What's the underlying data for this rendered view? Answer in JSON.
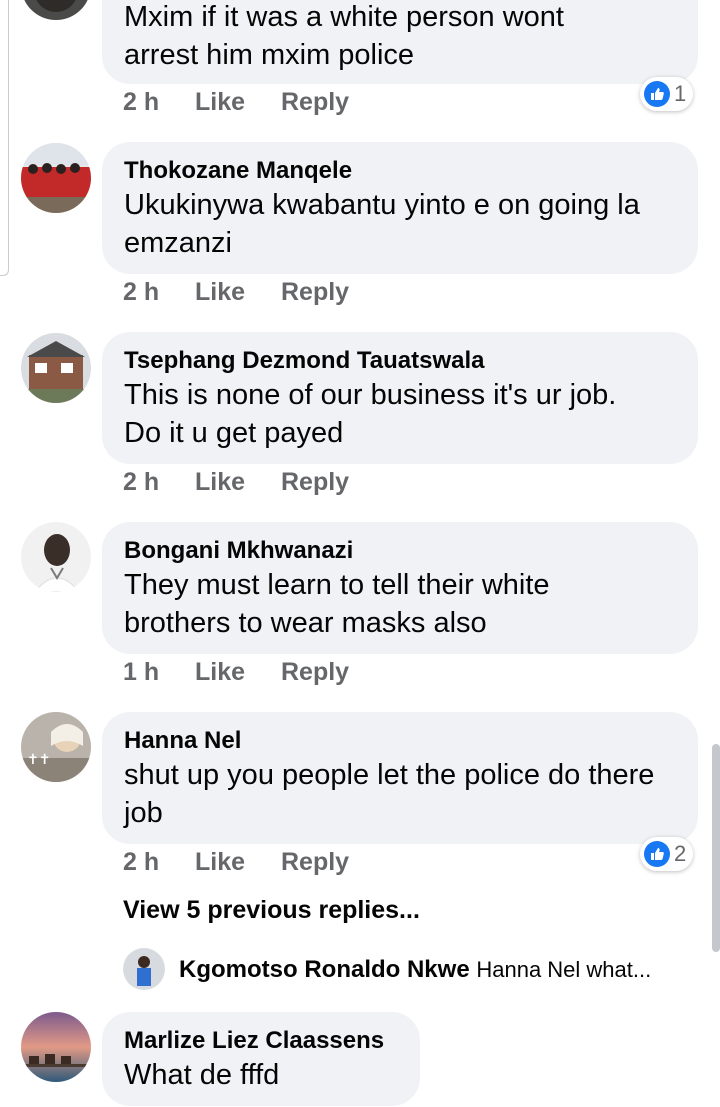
{
  "comments": [
    {
      "author": "",
      "text_lines": [
        "Mxim if it was a white person wont",
        "arrest him mxim police"
      ],
      "time": "2 h",
      "like_label": "Like",
      "reply_label": "Reply",
      "reaction": {
        "icon": "like-icon",
        "count": "1"
      }
    },
    {
      "author": "Thokozane Manqele",
      "text_lines": [
        "Ukukinywa kwabantu yinto e on going la",
        "emzanzi"
      ],
      "time": "2 h",
      "like_label": "Like",
      "reply_label": "Reply"
    },
    {
      "author": "Tsephang Dezmond Tauatswala",
      "text_lines": [
        "This is none of our business it's ur job.",
        "Do it u get payed"
      ],
      "time": "2 h",
      "like_label": "Like",
      "reply_label": "Reply"
    },
    {
      "author": "Bongani Mkhwanazi",
      "text_lines": [
        "They must learn to tell their white",
        "brothers to wear masks also"
      ],
      "time": "1 h",
      "like_label": "Like",
      "reply_label": "Reply"
    },
    {
      "author": "Hanna Nel",
      "text_lines": [
        "shut up you people let the police do there",
        "job"
      ],
      "time": "2 h",
      "like_label": "Like",
      "reply_label": "Reply",
      "reaction": {
        "icon": "like-icon",
        "count": "2"
      }
    },
    {
      "author": "Marlize Liez Claassens",
      "text_lines": [
        "What de fffd"
      ]
    }
  ],
  "view_replies": "View 5 previous replies...",
  "latest_reply": {
    "author": "Kgomotso Ronaldo Nkwe",
    "snippet": "Hanna Nel what..."
  },
  "colors": {
    "bubble": "#f0f2f5",
    "meta_text": "#65676b",
    "like_blue": "#1877f2"
  }
}
